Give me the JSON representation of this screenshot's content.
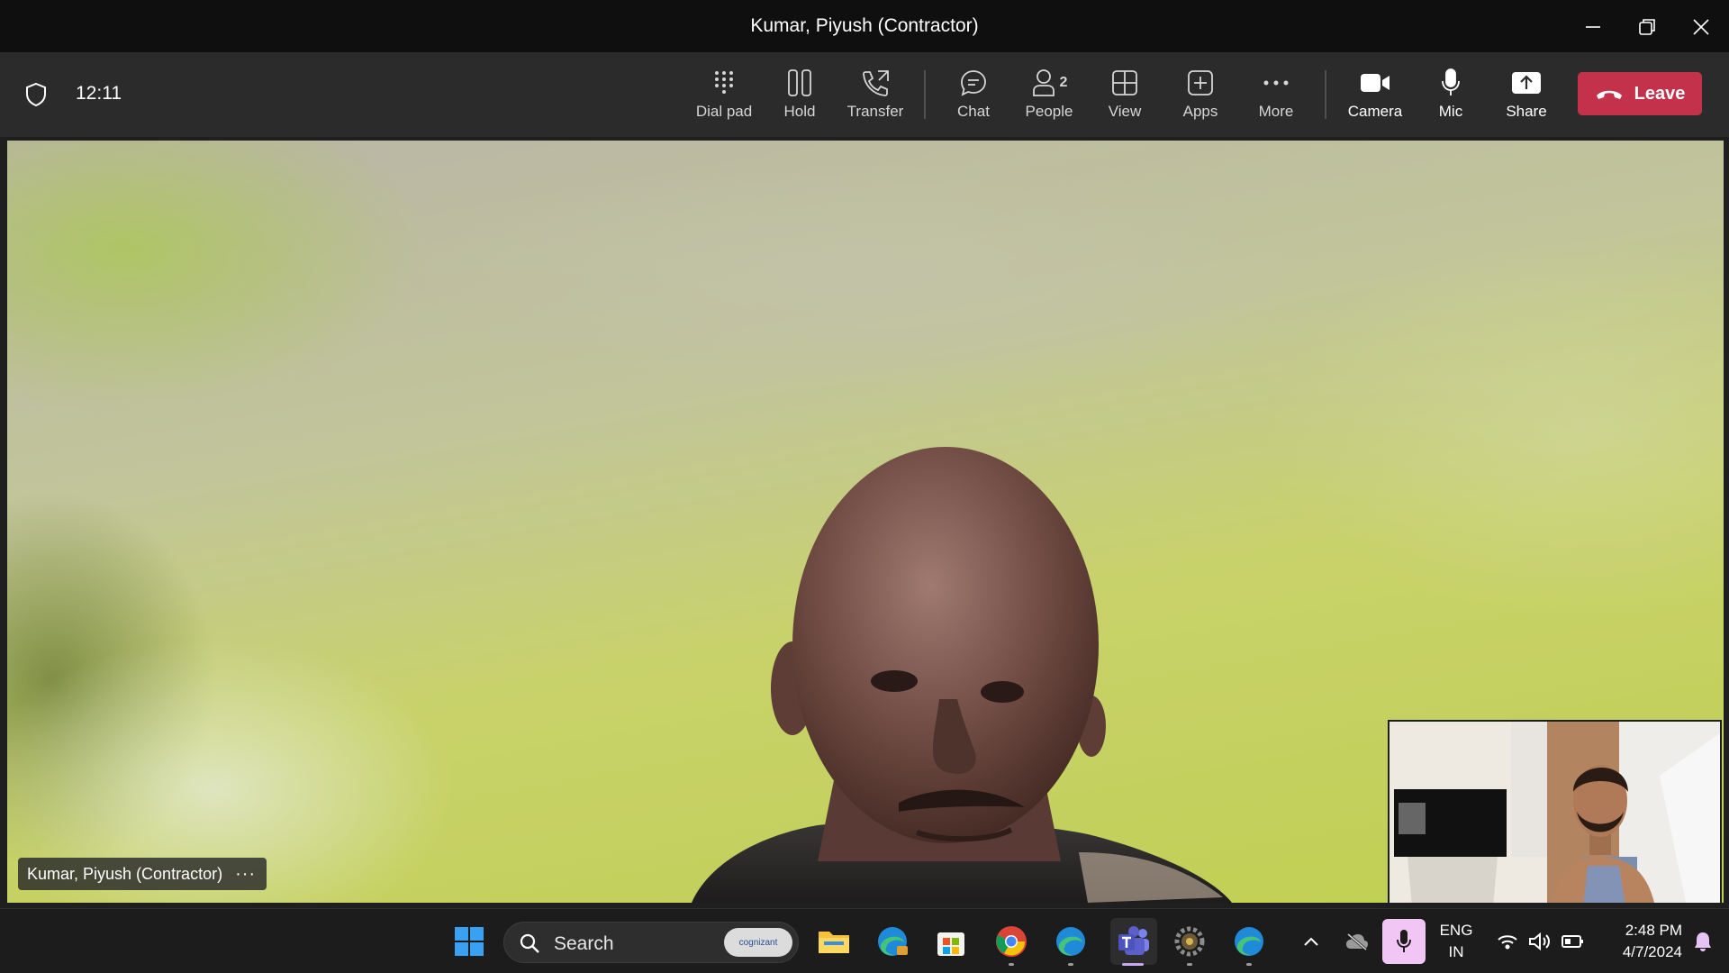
{
  "window": {
    "title": "Kumar, Piyush (Contractor)"
  },
  "toolbar": {
    "timer": "12:11",
    "buttons": [
      {
        "id": "dialpad",
        "label": "Dial pad",
        "icon": "dialpad-icon"
      },
      {
        "id": "hold",
        "label": "Hold",
        "icon": "pause-icon"
      },
      {
        "id": "transfer",
        "label": "Transfer",
        "icon": "phone-transfer-icon"
      },
      {
        "id": "chat",
        "label": "Chat",
        "icon": "chat-bubble-icon"
      },
      {
        "id": "people",
        "label": "People",
        "icon": "person-icon",
        "count": "2"
      },
      {
        "id": "view",
        "label": "View",
        "icon": "grid-icon"
      },
      {
        "id": "apps",
        "label": "Apps",
        "icon": "plus-square-icon"
      },
      {
        "id": "more",
        "label": "More",
        "icon": "ellipsis-icon"
      },
      {
        "id": "camera",
        "label": "Camera",
        "icon": "video-camera-icon"
      },
      {
        "id": "mic",
        "label": "Mic",
        "icon": "microphone-icon"
      },
      {
        "id": "share",
        "label": "Share",
        "icon": "share-upload-icon"
      }
    ],
    "leave_label": "Leave",
    "leave_color": "#c4314b"
  },
  "stage": {
    "participant_name": "Kumar, Piyush (Contractor)",
    "more_glyph": "···"
  },
  "taskbar": {
    "search_label": "Search",
    "search_badge": "cognizant",
    "language": "ENG",
    "region": "IN",
    "time": "2:48 PM",
    "date": "4/7/2024",
    "accent": "#7f85f5"
  }
}
